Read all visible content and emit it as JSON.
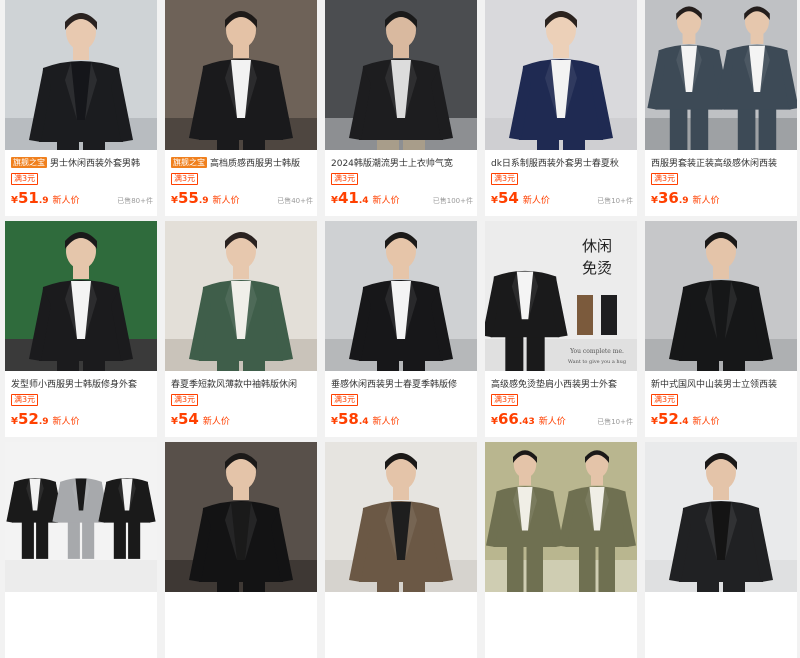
{
  "colors": {
    "accent": "#ff4000",
    "badge": "#f0801e"
  },
  "products": [
    {
      "badge": "旗舰之宝",
      "title": "男士休闲西装外套男韩",
      "tag": "满3元",
      "price_int": "51",
      "price_dec": ".9",
      "new_label": "新人价",
      "sold": "已售80+件"
    },
    {
      "badge": "旗舰之宝",
      "title": "高档质感西服男士韩版",
      "tag": "满3元",
      "price_int": "55",
      "price_dec": ".9",
      "new_label": "新人价",
      "sold": "已售40+件"
    },
    {
      "badge": "",
      "title": "2024韩版潮流男士上衣帅气宽",
      "tag": "满3元",
      "price_int": "41",
      "price_dec": ".4",
      "new_label": "新人价",
      "sold": "已售100+件"
    },
    {
      "badge": "",
      "title": "dk日系制服西装外套男士春夏秋",
      "tag": "满3元",
      "price_int": "54",
      "price_dec": "",
      "new_label": "新人价",
      "sold": "已售10+件"
    },
    {
      "badge": "",
      "title": "西服男套装正装高级感休闲西装",
      "tag": "满3元",
      "price_int": "36",
      "price_dec": ".9",
      "new_label": "新人价",
      "sold": ""
    },
    {
      "badge": "",
      "title": "发型师小西服男士韩版修身外套",
      "tag": "满3元",
      "price_int": "52",
      "price_dec": ".9",
      "new_label": "新人价",
      "sold": ""
    },
    {
      "badge": "",
      "title": "春夏季短款风薄款中袖韩版休闲",
      "tag": "满3元",
      "price_int": "54",
      "price_dec": "",
      "new_label": "新人价",
      "sold": ""
    },
    {
      "badge": "",
      "title": "垂感休闲西装男士春夏季韩版修",
      "tag": "满3元",
      "price_int": "58",
      "price_dec": ".4",
      "new_label": "新人价",
      "sold": ""
    },
    {
      "badge": "",
      "title": "高级感免烫垫肩小西装男士外套",
      "tag": "满3元",
      "price_int": "66",
      "price_dec": ".43",
      "new_label": "新人价",
      "sold": "已售10+件"
    },
    {
      "badge": "",
      "title": "新中式国风中山装男士立领西装",
      "tag": "满3元",
      "price_int": "52",
      "price_dec": ".4",
      "new_label": "新人价",
      "sold": ""
    },
    {
      "badge": "",
      "title": "",
      "tag": "",
      "price_int": "",
      "price_dec": "",
      "new_label": "",
      "sold": ""
    },
    {
      "badge": "",
      "title": "",
      "tag": "",
      "price_int": "",
      "price_dec": "",
      "new_label": "",
      "sold": ""
    },
    {
      "badge": "",
      "title": "",
      "tag": "",
      "price_int": "",
      "price_dec": "",
      "new_label": "",
      "sold": ""
    },
    {
      "badge": "",
      "title": "",
      "tag": "",
      "price_int": "",
      "price_dec": "",
      "new_label": "",
      "sold": ""
    },
    {
      "badge": "",
      "title": "",
      "tag": "",
      "price_int": "",
      "price_dec": "",
      "new_label": "",
      "sold": ""
    }
  ],
  "image_texts": {
    "p9_line1": "休闲",
    "p9_line2": "免烫",
    "p9_line3": "You complete me.",
    "p9_line4": "Want to give you a hug"
  }
}
